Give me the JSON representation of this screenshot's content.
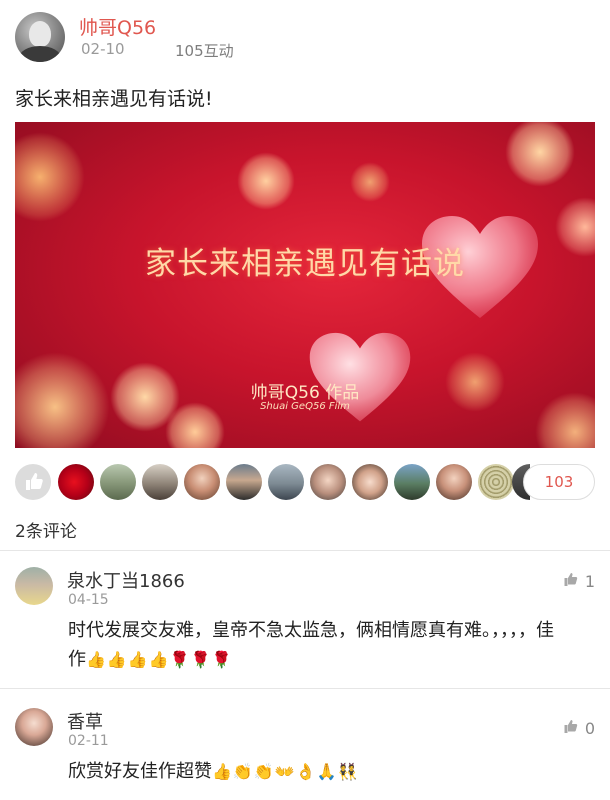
{
  "post": {
    "author": "帅哥Q56",
    "date": "02-10",
    "interactions": "105互动",
    "text": "家长来相亲遇见有话说!"
  },
  "video": {
    "title": "家长来相亲遇见有话说",
    "credit": "帅哥Q56 作品",
    "credit_sub": "Shuai GeQ56 Film"
  },
  "likes": {
    "count": "103",
    "avatars": [
      "roses-avatar",
      "man-avatar",
      "group-avatar",
      "woman-avatar",
      "sunglasses-avatar",
      "standing-man-avatar",
      "child-avatar",
      "girl-avatar",
      "outdoor-avatar",
      "woman2-avatar",
      "fan-avatar",
      "partial-avatar"
    ]
  },
  "comments_section": {
    "title": "2条评论",
    "items": [
      {
        "name": "泉水丁当1866",
        "date": "04-15",
        "likes": "1",
        "text": "时代发展交友难，皇帝不急太监急，俩相情愿真有难。，，，，佳作",
        "emojis": "👍👍👍👍🌹🌹🌹"
      },
      {
        "name": "香草",
        "date": "02-11",
        "likes": "0",
        "text": "欣赏好友佳作超赞",
        "emojis": "👍👏👏👐👌🙏👯"
      }
    ]
  },
  "colors": {
    "accent": "#e0574f",
    "video_red": "#c7142c"
  }
}
